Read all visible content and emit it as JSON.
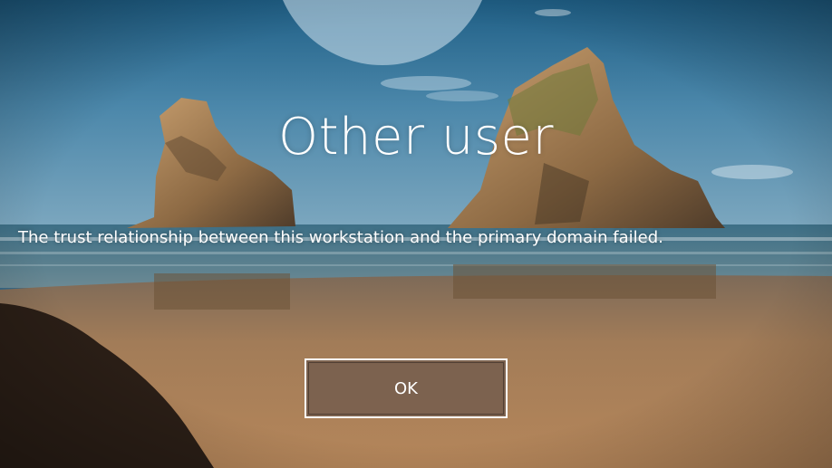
{
  "lock_screen": {
    "user_name": "Other user",
    "message": "The trust relationship between this workstation and the primary domain failed.",
    "ok_label": "OK"
  },
  "colors": {
    "sky": "#2f6f96",
    "sand": "#a8784e",
    "button_fill": "#7a604e",
    "text": "#ffffff"
  }
}
